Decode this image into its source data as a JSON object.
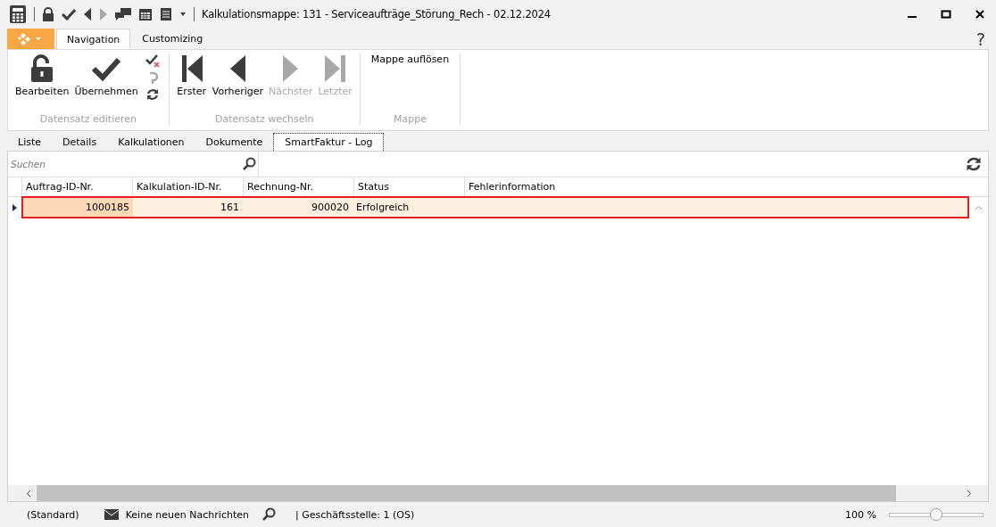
{
  "window": {
    "title": "Kalkulationsmappe: 131 - Serviceaufträge_Störung_Rech - 02.12.2024"
  },
  "ribbon": {
    "tabs": [
      {
        "label": "Navigation",
        "selected": true
      },
      {
        "label": "Customizing",
        "selected": false
      }
    ],
    "help": "?",
    "groups": [
      {
        "label": "Datensatz editieren",
        "buttons": [
          {
            "kind": "unlock",
            "label": "Bearbeiten",
            "disabled": false
          },
          {
            "kind": "check",
            "label": "Übernehmen",
            "disabled": false
          }
        ],
        "small_tools": [
          {
            "kind": "discard",
            "disabled": false
          },
          {
            "kind": "undo",
            "disabled": true
          },
          {
            "kind": "refresh",
            "disabled": false
          }
        ]
      },
      {
        "label": "Datensatz wechseln",
        "buttons": [
          {
            "kind": "first",
            "label": "Erster",
            "disabled": false
          },
          {
            "kind": "prev",
            "label": "Vorheriger",
            "disabled": false
          },
          {
            "kind": "next",
            "label": "Nächster",
            "disabled": true
          },
          {
            "kind": "last",
            "label": "Letzter",
            "disabled": true
          }
        ]
      },
      {
        "label": "Mappe",
        "buttons": [
          {
            "kind": "text",
            "label": "Mappe auflösen",
            "disabled": false
          }
        ]
      }
    ]
  },
  "tabs": [
    {
      "label": "Liste",
      "selected": false
    },
    {
      "label": "Details",
      "selected": false
    },
    {
      "label": "Kalkulationen",
      "selected": false
    },
    {
      "label": "Dokumente",
      "selected": false
    },
    {
      "label": "SmartFaktur - Log",
      "selected": true
    }
  ],
  "search": {
    "placeholder": "Suchen"
  },
  "table": {
    "columns": [
      "Auftrag-ID-Nr.",
      "Kalkulation-ID-Nr.",
      "Rechnung-Nr.",
      "Status",
      "Fehlerinformation"
    ],
    "rows": [
      {
        "selected": true,
        "cells": [
          "1000185",
          "161",
          "900020",
          "Erfolgreich"
        ]
      }
    ]
  },
  "status_bar": {
    "profile": "(Standard)",
    "messages": "Keine neuen Nachrichten",
    "branch": "| Geschäftsstelle:  1 (OS)",
    "zoom": "100 %",
    "zoom_level": {
      "level": 0.5
    }
  }
}
